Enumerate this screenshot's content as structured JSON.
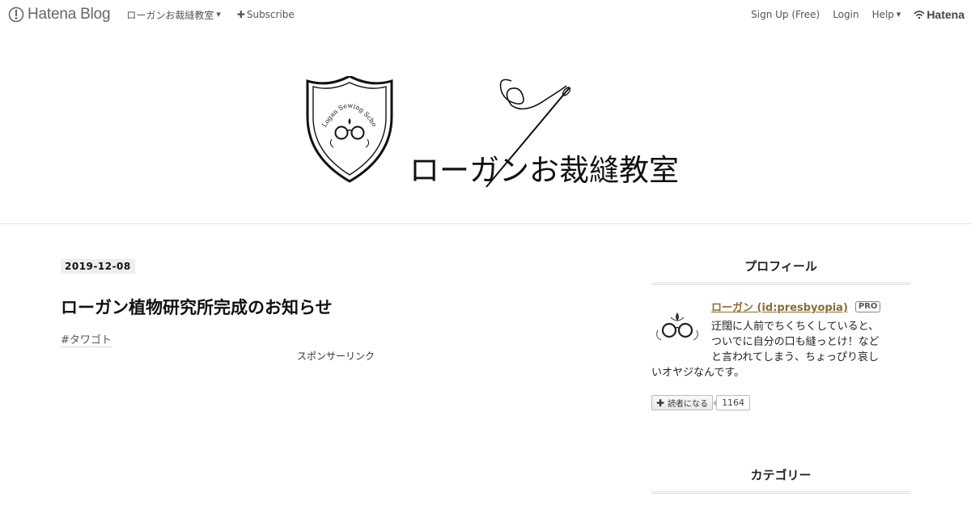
{
  "globalbar": {
    "brand": "Hatena Blog",
    "blog_menu": "ローガンお裁縫教室",
    "subscribe": "Subscribe",
    "signup": "Sign Up (Free)",
    "login": "Login",
    "help": "Help",
    "hatena": "Hatena"
  },
  "header": {
    "title": "ローガンお裁縫教室",
    "crest_text": "Logan Sewing School"
  },
  "entry": {
    "date": "2019-12-08",
    "title": "ローガン植物研究所完成のお知らせ",
    "tag": "#タワゴト",
    "sponsor": "スポンサーリンク"
  },
  "sidebar": {
    "profile_title": "プロフィール",
    "profile_name": "ローガン (id:presbyopia)",
    "pro_badge": "PRO",
    "profile_desc_lines": [
      "迂闊に人前でちくちくしていると、",
      "ついでに自分の口も縫っとけ！など",
      "と言われてしまう、ちょっぴり哀し",
      "いオヤジなんです。"
    ],
    "subscribe_label": "読者になる",
    "subscriber_count": "1164",
    "category_title": "カテゴリー"
  },
  "colors": {
    "accent_link": "#8a6d34",
    "divider": "#dddddd",
    "date_bg": "#eeeeee"
  }
}
